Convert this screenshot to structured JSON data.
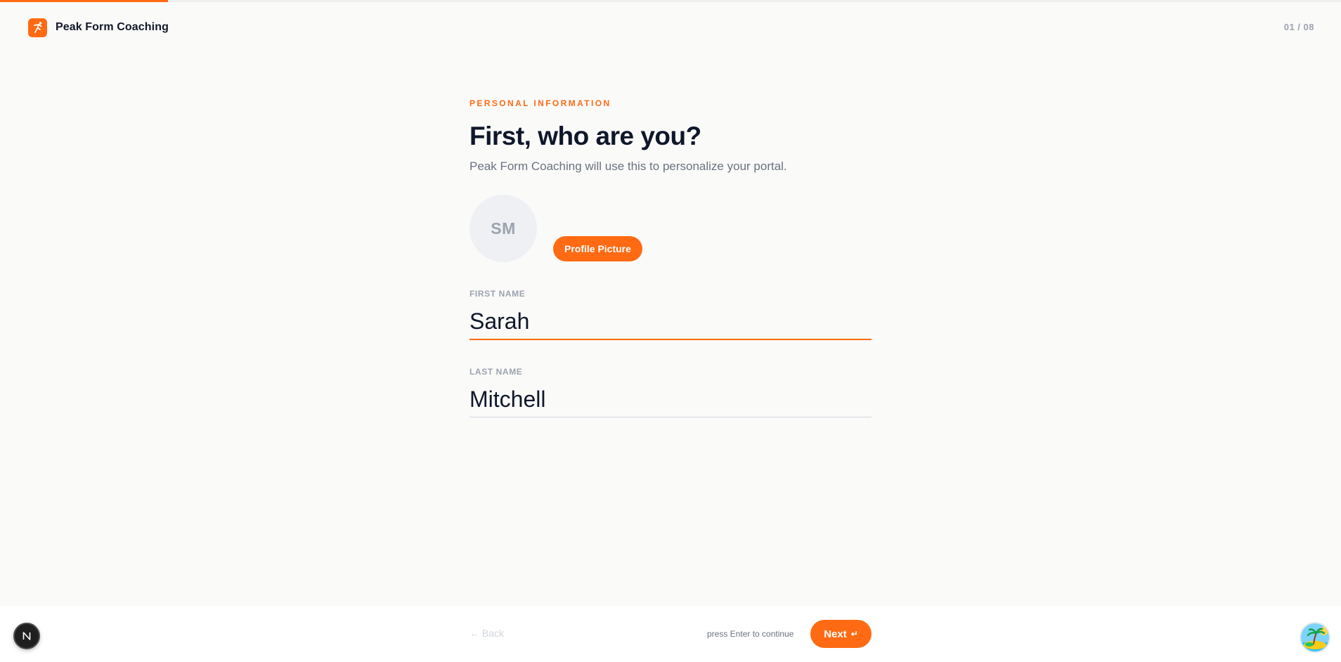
{
  "progress": {
    "fraction": 0.125,
    "color": "#ff6a13"
  },
  "brand": {
    "name": "Peak Form Coaching",
    "logo_icon": "runner-icon",
    "accent": "#ff6a13"
  },
  "step_counter": "01 / 08",
  "section": {
    "eyebrow": "PERSONAL INFORMATION",
    "title": "First, who are you?",
    "subtitle": "Peak Form Coaching will use this to personalize your portal."
  },
  "avatar": {
    "initials": "SM"
  },
  "profile_button": {
    "label": "Profile Picture"
  },
  "fields": {
    "first_name": {
      "label": "FIRST NAME",
      "value": "Sarah"
    },
    "last_name": {
      "label": "LAST NAME",
      "value": "Mitchell"
    }
  },
  "footer": {
    "back_label": "← Back",
    "hint": "press Enter to continue",
    "next_label": "Next",
    "next_icon": "enter-icon"
  },
  "corner_badges": {
    "left_letter": "N",
    "right_icon": "island-icon"
  }
}
